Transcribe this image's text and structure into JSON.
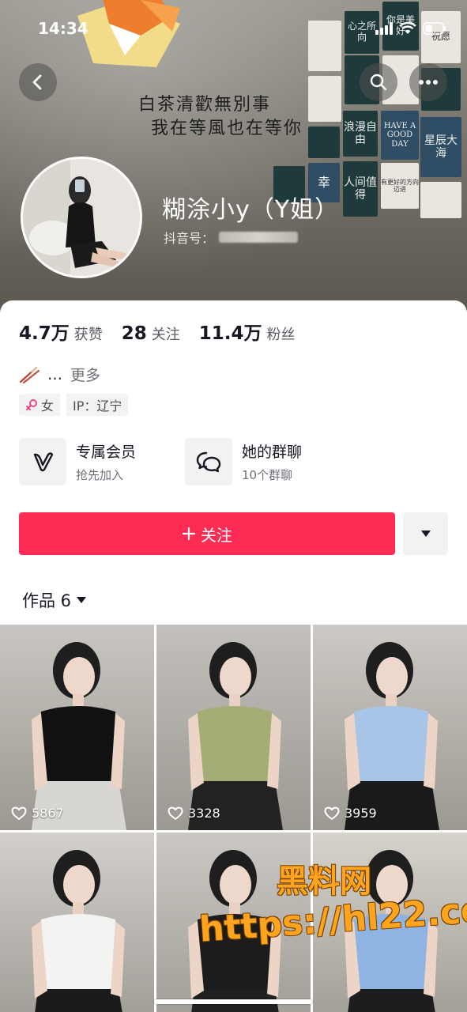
{
  "status_bar": {
    "time": "14:34"
  },
  "cover": {
    "calligraphy_line1": "白茶清歡無別事",
    "calligraphy_line2": "我在等風也在等你",
    "posters": [
      "心之所向",
      "你是美好",
      "祝愿",
      "浪漫自由",
      "HAVE A GOOD DAY",
      "星辰大海",
      "幸",
      "人间值得",
      "有更好的方向迈进"
    ]
  },
  "profile": {
    "nickname": "糊涂小y（Y姐）",
    "douyin_id_label": "抖音号："
  },
  "stats": [
    {
      "value": "4.7万",
      "label": "获赞"
    },
    {
      "value": "28",
      "label": "关注"
    },
    {
      "value": "11.4万",
      "label": "粉丝"
    }
  ],
  "bio": {
    "text": "…",
    "more": "更多"
  },
  "tags": {
    "gender": "女",
    "ip": "IP：辽宁"
  },
  "features": [
    {
      "title": "专属会员",
      "subtitle": "抢先加入",
      "icon": "vip-v-icon"
    },
    {
      "title": "她的群聊",
      "subtitle": "10个群聊",
      "icon": "group-chat-icon"
    }
  ],
  "actions": {
    "follow_label": "关注"
  },
  "works": {
    "tab_label": "作品 6"
  },
  "videos": [
    {
      "likes": "5867",
      "top": "#c9c6c1",
      "shirt": "#111111",
      "bottom": "#d8d6d2"
    },
    {
      "likes": "3328",
      "top": "#c3c0bc",
      "shirt": "#a4ad75",
      "bottom": "#222222"
    },
    {
      "likes": "3959",
      "top": "#cdc9c4",
      "shirt": "#a8c4e6",
      "bottom": "#1a1a1a"
    },
    {
      "likes": "",
      "top": "#d3d0cc",
      "shirt": "#f3f3f1",
      "bottom": "#1b1b1b"
    },
    {
      "likes": "",
      "top": "#cbc8c3",
      "shirt": "#1c1c1c",
      "bottom": "#202020"
    },
    {
      "likes": "",
      "top": "#d6d2cc",
      "shirt": "#8fb4e3",
      "bottom": "#1d1d1d"
    }
  ],
  "watermark": {
    "line1": "黑料网",
    "line2": "https://hl22.co"
  },
  "colors": {
    "accent": "#fe2c55",
    "text": "#161823",
    "muted": "#6d6f76"
  }
}
